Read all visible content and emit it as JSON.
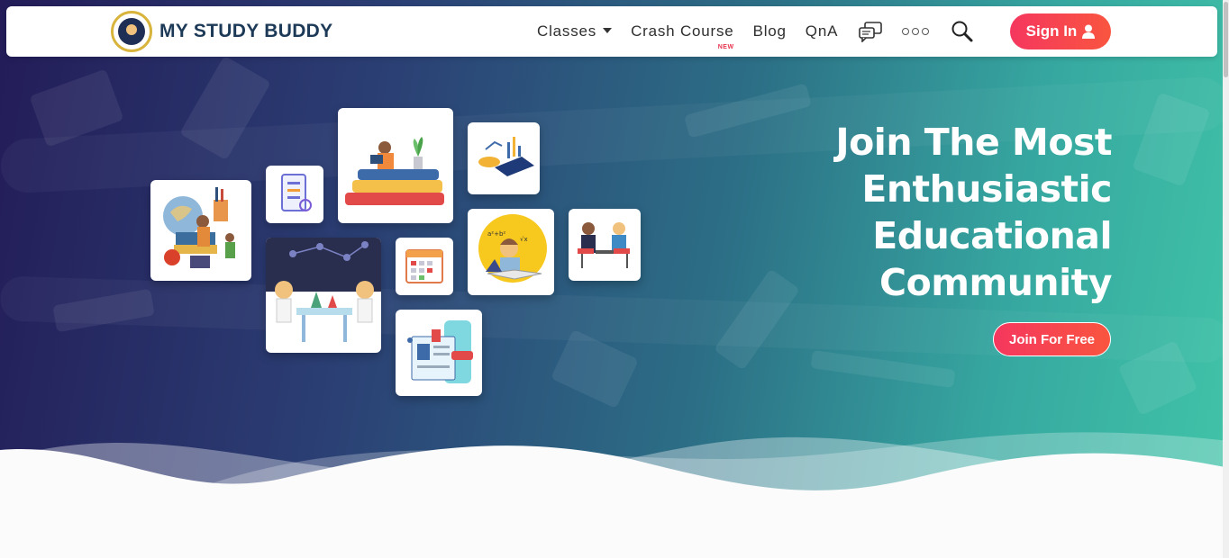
{
  "brand": {
    "name": "MY STUDY BUDDY"
  },
  "nav": {
    "classes": "Classes",
    "crash_course": "Crash Course",
    "crash_badge": "NEW",
    "blog": "Blog",
    "qna": "QnA",
    "signin": "Sign In"
  },
  "hero": {
    "headline": [
      "Join The Most",
      "Enthusiastic",
      "Educational",
      "Community"
    ],
    "cta": "Join For Free"
  },
  "icons": {
    "chat": "chat-bubbles-icon",
    "more": "more-dots-icon",
    "search": "search-icon",
    "user": "user-icon",
    "dropdown": "caret-down-icon"
  },
  "colors": {
    "brand_text": "#1c3a57",
    "button_gradient_start": "#f5375f",
    "button_gradient_end": "#f9553f",
    "hero_gradient_start": "#231c58",
    "hero_gradient_end": "#41c5a8"
  }
}
